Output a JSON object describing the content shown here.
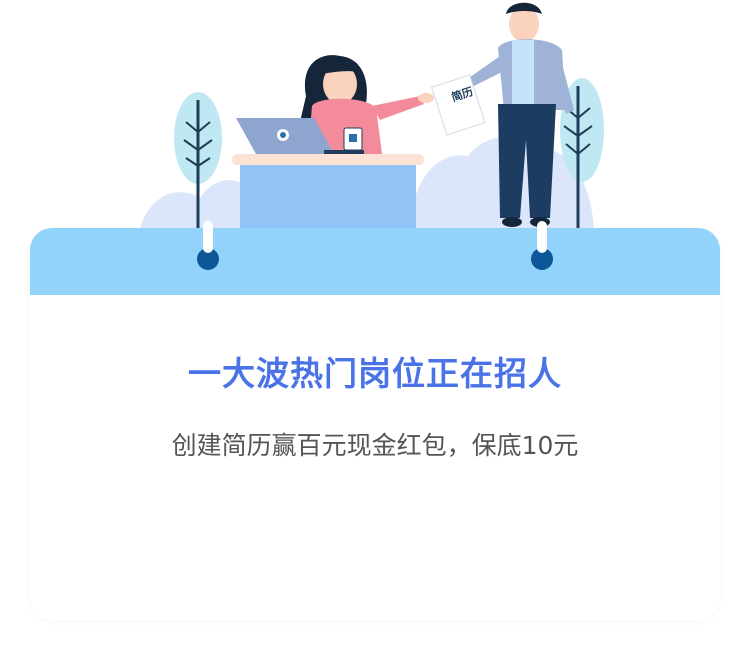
{
  "illustration": {
    "resume_label": "简历"
  },
  "card": {
    "headline": "一大波热门岗位正在招人",
    "subline": "创建简历赢百元现金红包，保底10元"
  },
  "colors": {
    "headline": "#4b73e8",
    "band": "#92d3fc",
    "ring": "#0d5697"
  }
}
